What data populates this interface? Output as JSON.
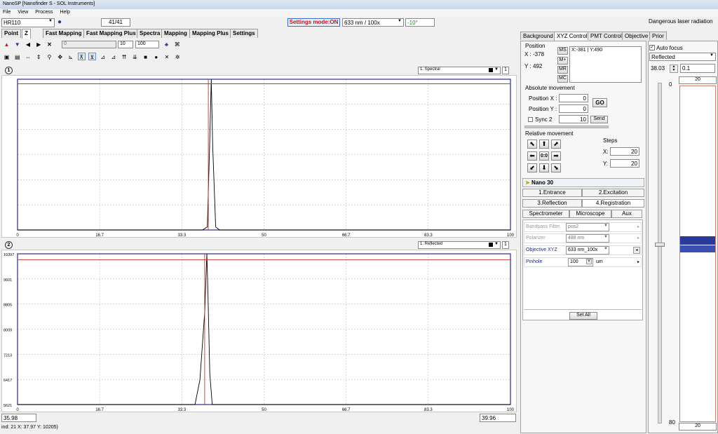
{
  "window": {
    "title": "NanoSP [Nanofinder S - SOL Instruments]"
  },
  "menu": [
    "File",
    "View",
    "Process",
    "Help"
  ],
  "topbar": {
    "device": "HR110",
    "counter": "41/41",
    "settings_mode": "Settings mode:ON",
    "laser_objective": "633 nm / 100x",
    "angle": "-10°",
    "warning": "Dangerous laser radiation"
  },
  "left_tabs": [
    "Point",
    "Z",
    "Fast Mapping",
    "Fast Mapping Plus",
    "Spectra",
    "Mapping",
    "Mapping Plus",
    "Settings"
  ],
  "toolbar": {
    "field_a": "10",
    "field_b": "100",
    "slider_value": "0"
  },
  "plot1": {
    "number": "1",
    "selector": "1. Spectral",
    "count": "1"
  },
  "plot2": {
    "number": "2",
    "selector": "1. Reflected",
    "count": "1"
  },
  "bottom": {
    "left_value": "35.98",
    "right_value": "39.96",
    "status": "ind: 21 X: 37.97 Y: 10205)"
  },
  "right_tabs": [
    "Background",
    "XYZ Control",
    "PMT Control",
    "Objective",
    "Prior"
  ],
  "xyz": {
    "position_title": "Position",
    "x_label": "X :",
    "x_value": "-378",
    "y_label": "Y :",
    "y_value": "492",
    "ms": "MS",
    "mplus": "M+",
    "mr": "MR",
    "mc": "MC",
    "memory_entry": "X:-381 | Y:490",
    "abs_title": "Absolute movement",
    "pos_x_label": "Position X :",
    "pos_x_value": "0",
    "pos_y_label": "Position Y :",
    "pos_y_value": "0",
    "go": "GO",
    "sync_label": "Sync 2",
    "sync_value": "10",
    "send": "Send",
    "rel_title": "Relative movement",
    "steps_title": "Steps",
    "steps_x_label": "X:",
    "steps_x": "20",
    "steps_y_label": "Y:",
    "steps_y": "20",
    "center": "0:0"
  },
  "right_side": {
    "autofocus": "Auto focus",
    "mode": "Reflected",
    "focus_value": "38.03",
    "step_value": "0.1",
    "scale_top": "0",
    "scale_bottom": "80",
    "bar_top": "20",
    "bar_bottom": "20"
  },
  "nano": {
    "title": "Nano 30",
    "tabs": [
      "1.Entrance",
      "2.Excitation",
      "3.Reflection",
      "4.Registration"
    ],
    "subtabs": [
      "Spectrometer",
      "Microscope",
      "Aux"
    ],
    "rows": [
      {
        "label": "Bandpass Filter",
        "value": "pos2"
      },
      {
        "label": "Polarizer",
        "value": "488 nm"
      },
      {
        "label": "Objective XYZ",
        "value": "633 nm_100x"
      },
      {
        "label": "Pinhole",
        "value": "100",
        "unit": "um"
      }
    ],
    "set_all": "Set All"
  },
  "chart_data": [
    {
      "type": "line",
      "title": "",
      "xlim": [
        0,
        100
      ],
      "x_ticks": [
        "0",
        "16.7",
        "33.3",
        "50",
        "66.7",
        "83.3",
        "100"
      ],
      "y_ticks": [],
      "series": [
        {
          "color": "#000000",
          "x": [
            0,
            37.5,
            38.5,
            39.0,
            39.3,
            39.6,
            40.2,
            41.0,
            100
          ],
          "y": [
            0,
            0,
            2,
            60,
            100,
            55,
            2,
            0,
            0
          ]
        },
        {
          "color": "#cc3322",
          "x": [
            0,
            100
          ],
          "y": [
            97,
            97
          ]
        },
        {
          "color": "#cc3322",
          "x": [
            38.7,
            38.7
          ],
          "y": [
            0,
            100
          ]
        }
      ]
    },
    {
      "type": "line",
      "title": "",
      "xlim": [
        0,
        100
      ],
      "ylim": [
        5621,
        10397
      ],
      "x_ticks": [
        "0",
        "16.7",
        "33.3",
        "50",
        "66.7",
        "83.3",
        "100"
      ],
      "y_ticks": [
        "10397",
        "9601",
        "8805",
        "8009",
        "7213",
        "6417",
        "5621"
      ],
      "series": [
        {
          "color": "#000000",
          "x": [
            0,
            36.0,
            37.0,
            38.0,
            38.4,
            38.6,
            39.0,
            39.5,
            100
          ],
          "y": [
            5621,
            5621,
            6400,
            8600,
            10397,
            9300,
            6600,
            5621,
            5621
          ]
        },
        {
          "color": "#cc3322",
          "x": [
            0,
            100
          ],
          "y": [
            10205,
            10205
          ]
        },
        {
          "color": "#cc3322",
          "x": [
            37.97,
            37.97
          ],
          "y": [
            5621,
            10397
          ]
        }
      ]
    }
  ]
}
